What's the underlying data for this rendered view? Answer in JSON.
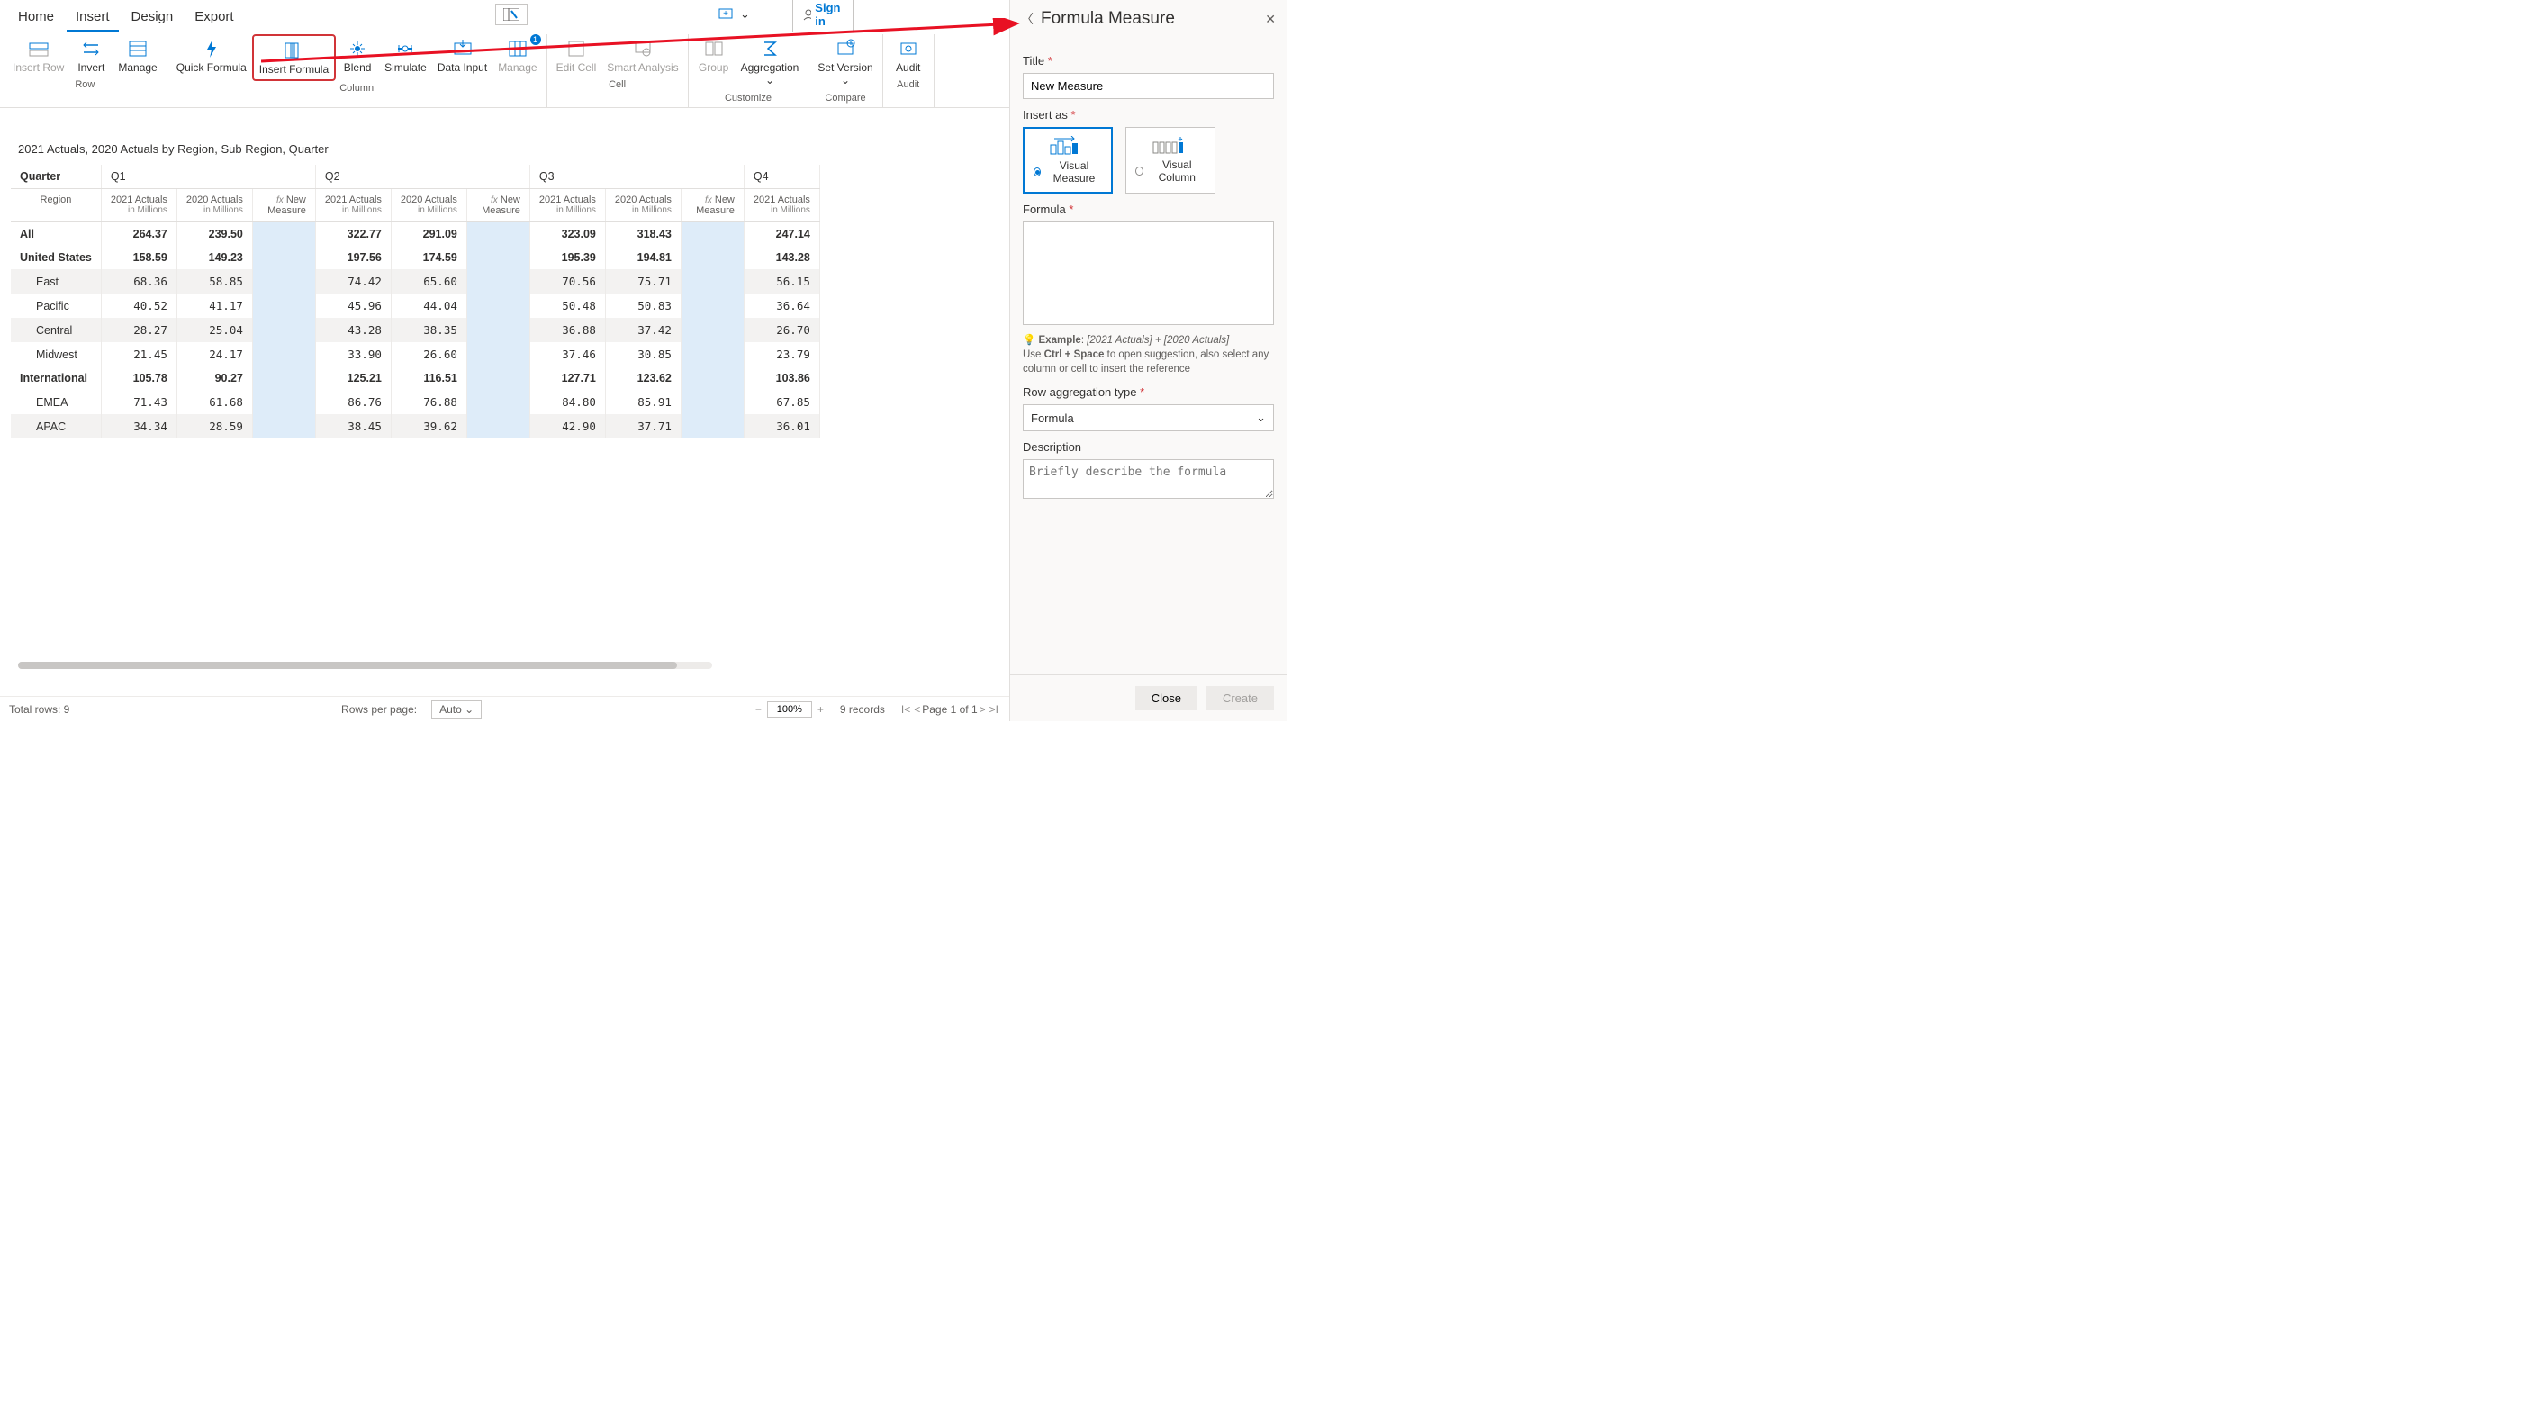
{
  "menu": {
    "home": "Home",
    "insert": "Insert",
    "design": "Design",
    "export": "Export"
  },
  "signin": "Sign in",
  "ribbon": {
    "row": {
      "insert_row": "Insert\nRow",
      "invert": "Invert",
      "manage": "Manage",
      "label": "Row"
    },
    "column": {
      "quick_formula": "Quick\nFormula",
      "insert_formula": "Insert\nFormula",
      "blend": "Blend",
      "simulate": "Simulate",
      "data_input": "Data\nInput",
      "manage": "Manage",
      "label": "Column"
    },
    "cell": {
      "edit_cell": "Edit\nCell",
      "smart_analysis": "Smart\nAnalysis",
      "label": "Cell"
    },
    "customize": {
      "group": "Group",
      "aggregation": "Aggregation",
      "label": "Customize"
    },
    "compare": {
      "set_version": "Set\nVersion",
      "label": "Compare"
    },
    "audit": {
      "audit": "Audit",
      "label": "Audit"
    }
  },
  "report_title": "2021 Actuals, 2020 Actuals by Region, Sub Region, Quarter",
  "hdr": {
    "quarter": "Quarter",
    "region": "Region",
    "q1": "Q1",
    "q2": "Q2",
    "q3": "Q3",
    "q4": "Q4",
    "c2021": "2021 Actuals",
    "c2020": "2020 Actuals",
    "sub": "in Millions",
    "new_measure": "New\nMeasure",
    "fx": "fx"
  },
  "rows": {
    "all": {
      "lbl": "All",
      "q1a": "264.37",
      "q1b": "239.50",
      "q2a": "322.77",
      "q2b": "291.09",
      "q3a": "323.09",
      "q3b": "318.43",
      "q4a": "247.14"
    },
    "us": {
      "lbl": "United States",
      "q1a": "158.59",
      "q1b": "149.23",
      "q2a": "197.56",
      "q2b": "174.59",
      "q3a": "195.39",
      "q3b": "194.81",
      "q4a": "143.28"
    },
    "east": {
      "lbl": "East",
      "q1a": "68.36",
      "q1b": "58.85",
      "q2a": "74.42",
      "q2b": "65.60",
      "q3a": "70.56",
      "q3b": "75.71",
      "q4a": "56.15"
    },
    "pac": {
      "lbl": "Pacific",
      "q1a": "40.52",
      "q1b": "41.17",
      "q2a": "45.96",
      "q2b": "44.04",
      "q3a": "50.48",
      "q3b": "50.83",
      "q4a": "36.64"
    },
    "cen": {
      "lbl": "Central",
      "q1a": "28.27",
      "q1b": "25.04",
      "q2a": "43.28",
      "q2b": "38.35",
      "q3a": "36.88",
      "q3b": "37.42",
      "q4a": "26.70"
    },
    "mid": {
      "lbl": "Midwest",
      "q1a": "21.45",
      "q1b": "24.17",
      "q2a": "33.90",
      "q2b": "26.60",
      "q3a": "37.46",
      "q3b": "30.85",
      "q4a": "23.79"
    },
    "intl": {
      "lbl": "International",
      "q1a": "105.78",
      "q1b": "90.27",
      "q2a": "125.21",
      "q2b": "116.51",
      "q3a": "127.71",
      "q3b": "123.62",
      "q4a": "103.86"
    },
    "emea": {
      "lbl": "EMEA",
      "q1a": "71.43",
      "q1b": "61.68",
      "q2a": "86.76",
      "q2b": "76.88",
      "q3a": "84.80",
      "q3b": "85.91",
      "q4a": "67.85"
    },
    "apac": {
      "lbl": "APAC",
      "q1a": "34.34",
      "q1b": "28.59",
      "q2a": "38.45",
      "q2b": "39.62",
      "q3a": "42.90",
      "q3b": "37.71",
      "q4a": "36.01"
    }
  },
  "status": {
    "total_rows": "Total rows: 9",
    "rows_per_page": "Rows per page:",
    "auto": "Auto",
    "zoom": "100%",
    "records": "9 records",
    "page": "Page 1 of 1"
  },
  "panel": {
    "title": "Formula Measure",
    "title_label": "Title",
    "title_value": "New Measure",
    "insert_as": "Insert as",
    "visual_measure": "Visual Measure",
    "visual_column": "Visual Column",
    "formula_label": "Formula",
    "example_label": "Example",
    "example_formula": "[2021 Actuals] + [2020 Actuals]",
    "hint1a": "Use ",
    "hint1b": "Ctrl + Space",
    "hint1c": " to open suggestion, also select any column or cell to insert the reference",
    "row_agg": "Row aggregation type",
    "row_agg_value": "Formula",
    "desc_label": "Description",
    "desc_placeholder": "Briefly describe the formula",
    "close": "Close",
    "create": "Create"
  }
}
